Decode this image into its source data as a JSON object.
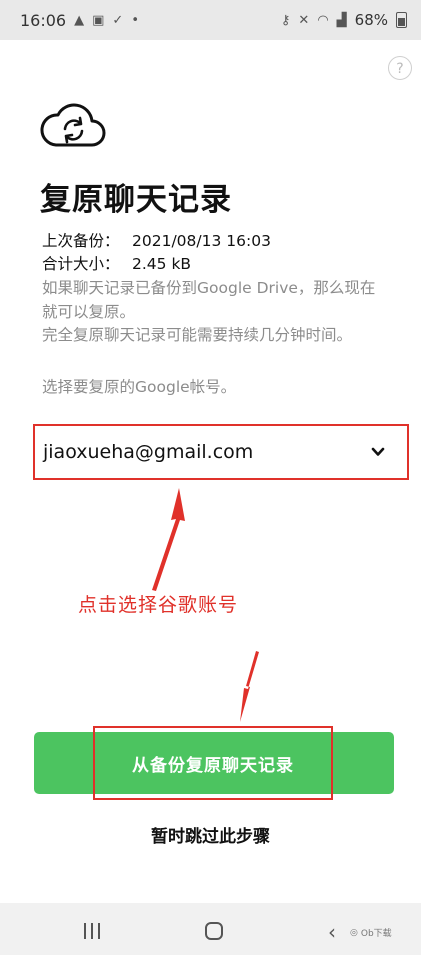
{
  "status_bar": {
    "time": "16:06",
    "battery": "68%"
  },
  "header": {
    "help_symbol": "?",
    "icon": "cloud-sync-icon",
    "title": "复原聊天记录"
  },
  "backup_info": {
    "last_backup_label": "上次备份：",
    "last_backup_value": "2021/08/13 16:03",
    "total_size_label": "合计大小：",
    "total_size_value": "2.45 kB"
  },
  "description": {
    "line1": "如果聊天记录已备份到Google Drive，那么现在就可以复原。",
    "line2": "完全复原聊天记录可能需要持续几分钟时间。"
  },
  "account": {
    "prompt": "选择要复原的Google帐号。",
    "selected": "jiaoxueha@gmail.com"
  },
  "annotation": {
    "text": "点击选择谷歌账号",
    "color": "#e0312a"
  },
  "actions": {
    "restore_label": "从备份复原聊天记录",
    "skip_label": "暂时跳过此步骤",
    "accent": "#4cc460"
  },
  "watermark": "Ob下载"
}
